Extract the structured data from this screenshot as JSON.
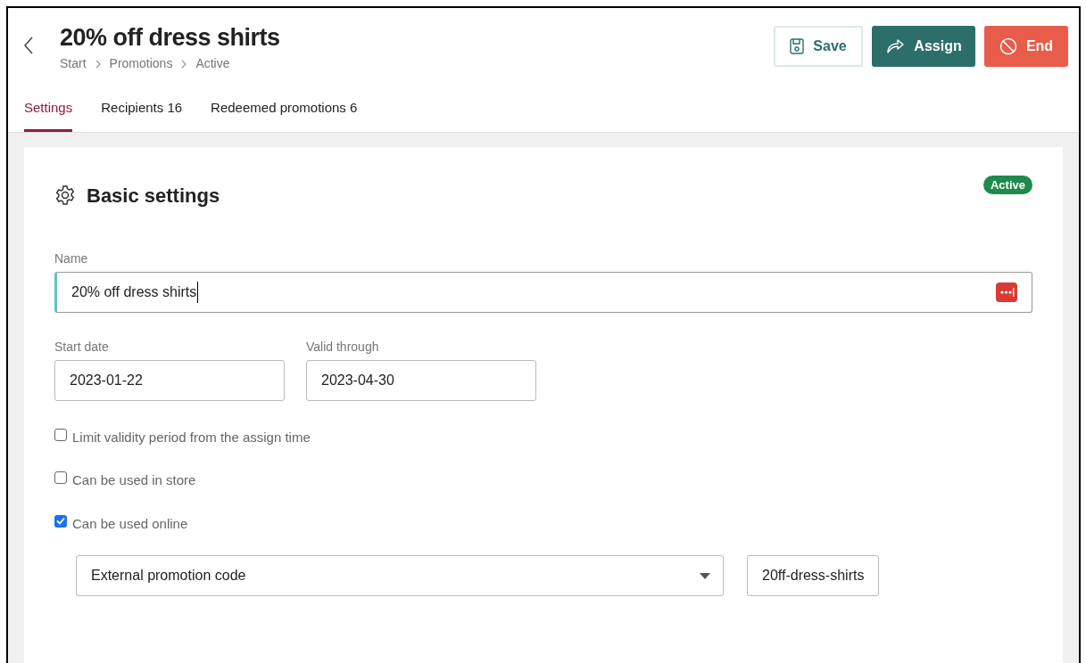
{
  "header": {
    "title": "20% off dress shirts",
    "breadcrumb": [
      "Start",
      "Promotions",
      "Active"
    ]
  },
  "actions": [
    {
      "kind": "save",
      "label": "Save"
    },
    {
      "kind": "assign",
      "label": "Assign"
    },
    {
      "kind": "end",
      "label": "End"
    }
  ],
  "tabs": [
    {
      "label": "Settings",
      "selected": true
    },
    {
      "label": "Recipients 16",
      "selected": false
    },
    {
      "label": "Redeemed promotions 6",
      "selected": false
    }
  ],
  "card": {
    "title": "Basic settings",
    "status": "Active",
    "name_field": {
      "label": "Name",
      "value": "20% off dress shirts",
      "focused": true
    },
    "date_fields": [
      {
        "label": "Start date",
        "value": "2023-01-22"
      },
      {
        "label": "Valid through",
        "value": "2023-04-30"
      }
    ],
    "options": [
      {
        "label": "Limit validity period from the assign time",
        "checked": false
      },
      {
        "label": "Can be used in store",
        "checked": false
      },
      {
        "label": "Can be used online",
        "checked": true
      }
    ],
    "code_type": {
      "value": "External promotion code"
    },
    "code": {
      "value": "20ff-dress-shirts"
    }
  }
}
